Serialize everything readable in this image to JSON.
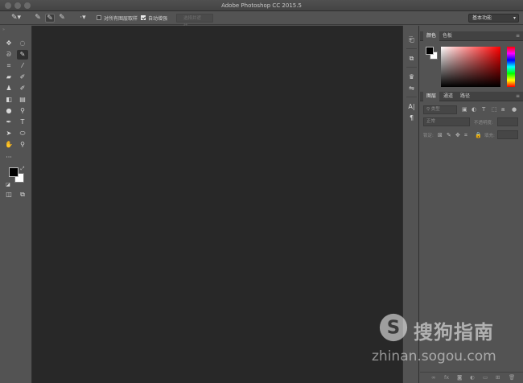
{
  "window": {
    "title": "Adobe Photoshop CC 2015.5"
  },
  "options_bar": {
    "sample_all_layers_label": "对所有图层取样",
    "sample_all_layers_checked": false,
    "auto_enhance_label": "自动增强",
    "auto_enhance_checked": true,
    "select_subject_button": "选择并遮住...",
    "workspace": "基本功能"
  },
  "color_panel": {
    "tabs": [
      "颜色",
      "色板"
    ],
    "active_tab": "颜色",
    "foreground_color": "#000000",
    "background_color": "#ffffff"
  },
  "layers_panel": {
    "tabs": [
      "图层",
      "通道",
      "路径"
    ],
    "active_tab": "图层",
    "filter_kind": "类型",
    "blend_mode": "正常",
    "opacity_label": "不透明度:",
    "lock_label": "锁定:",
    "fill_label": "填充:"
  },
  "watermark": {
    "brand": "搜狗指南",
    "url": "zhinan.sogou.com"
  },
  "colors": {
    "canvas_bg": "#282828",
    "ui_bg": "#535353",
    "panel_header": "#424242"
  }
}
